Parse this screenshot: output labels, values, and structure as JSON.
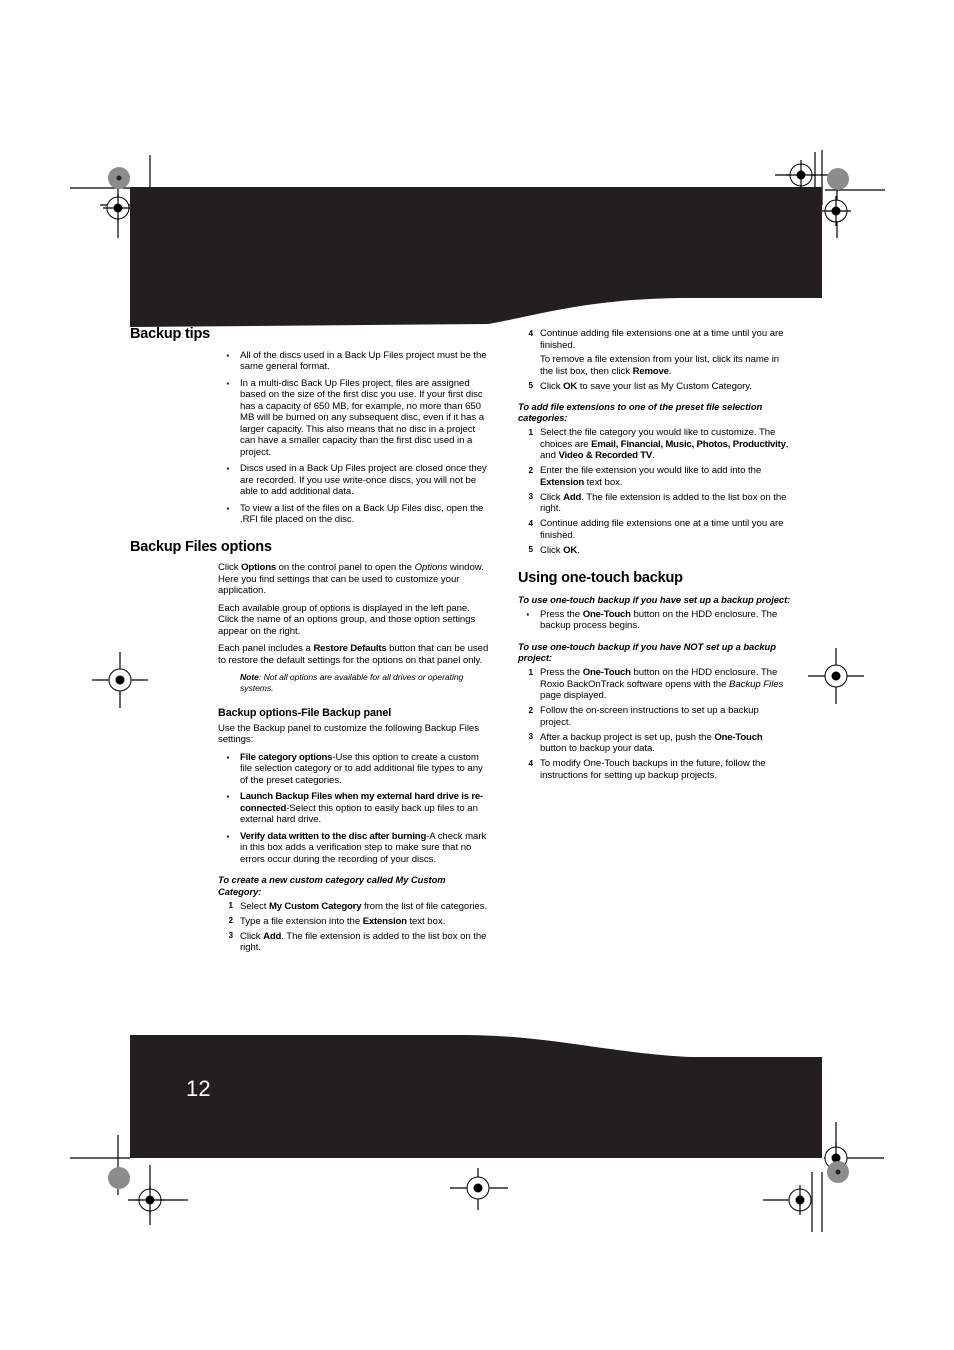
{
  "page": {
    "number": "12",
    "banner_color": "#231f20",
    "page_number_color": "#ffffff"
  },
  "left_column": {
    "backup_tips": {
      "heading": "Backup tips",
      "bullets": [
        "All of the discs used in a Back Up Files project must be the same general format.",
        "In a multi-disc Back Up Files project, files are assigned based on the size of the first disc you use. If your first disc has a capacity of 650 MB, for example, no more than 650 MB will be burned on any subsequent disc, even if it has a larger capacity. This also means that no disc in a project can have a smaller capacity than the first disc used in a project.",
        "Discs used in a Back Up Files project are closed once they are recorded. If you use write-once discs, you will not be able to add additional data.",
        "To view a list of the files on a Back Up Files disc, open the .RFI file placed on the disc."
      ]
    },
    "backup_files_options": {
      "heading": "Backup Files options",
      "paragraph_1": {
        "part_1": "Click ",
        "bold_1": "Options",
        "part_2": " on the control panel to open the ",
        "italic_1": "Options",
        "part_3": " window. Here you find settings that can be used to customize your application."
      },
      "paragraph_2": "Each available group of options is displayed in the left pane. Click the name of an options group, and those option settings appear on the right.",
      "paragraph_3": {
        "part_1": "Each panel includes a ",
        "bold_1": "Restore Defaults",
        "part_2": " button that can be used to restore the default settings for the options on that panel only."
      },
      "note": {
        "lead": "Note",
        "text": ": Not all options are available for all drives or operating systems."
      }
    },
    "file_backup_panel": {
      "heading": "Backup options-File Backup panel",
      "intro": "Use the Backup panel to customize the following Backup Files settings:",
      "bullets": [
        {
          "bold": "File category options",
          "rest": "-Use this option to create a custom file selection category or to add additional file types to any of the preset categories."
        },
        {
          "bold": "Launch Backup Files when my external hard drive is re-connected",
          "rest": "-Select this option to easily back up files to an external hard drive."
        },
        {
          "bold": "Verify data written to the disc after burning",
          "rest": "-A check mark in this box adds a verification step to make sure that no errors occur during the recording of your discs."
        }
      ]
    },
    "custom_category_procedure": {
      "title": "To create a new custom category called My Custom Category:",
      "steps": [
        {
          "num": "1",
          "part_1": "Select ",
          "bold_1": "My Custom Category",
          "part_2": " from the list of file categories."
        },
        {
          "num": "2",
          "part_1": "Type a file extension into the ",
          "bold_1": "Extension",
          "part_2": " text box."
        },
        {
          "num": "3",
          "part_1": "Click ",
          "bold_1": "Add",
          "part_2": ". The file extension is added to the list box on the right."
        }
      ]
    }
  },
  "right_column": {
    "continued_steps": [
      {
        "num": "4",
        "part_1": "Continue adding file extensions one at a time until you are finished.",
        "sub_part_1": "To remove a file extension from your list, click its name in the list box, then click ",
        "sub_bold_1": "Remove",
        "sub_part_2": "."
      },
      {
        "num": "5",
        "part_1": "Click ",
        "bold_1": "OK",
        "part_2": " to save your list as My Custom Category."
      }
    ],
    "preset_categories_procedure": {
      "title": "To add file extensions to one of the preset file selection categories:",
      "steps": [
        {
          "num": "1",
          "part_1": "Select the file category you would like to customize. The choices are ",
          "bold_1": "Email, Financial, Music, Photos, Productivity",
          "part_2": ", and ",
          "bold_2": "Video & Recorded TV",
          "part_3": "."
        },
        {
          "num": "2",
          "part_1": "Enter the file extension you would like to add into the ",
          "bold_1": "Extension",
          "part_2": " text box."
        },
        {
          "num": "3",
          "part_1": "Click ",
          "bold_1": "Add",
          "part_2": ". The file extension is added to the list box on the right."
        },
        {
          "num": "4",
          "part_1": "Continue adding file extensions one at a time until you are finished."
        },
        {
          "num": "5",
          "part_1": "Click ",
          "bold_1": "OK",
          "part_2": "."
        }
      ]
    },
    "one_touch_backup": {
      "heading": "Using one-touch backup",
      "procedure_set_up": {
        "title": "To use one-touch backup if you have set up a backup project:",
        "bullet": {
          "part_1": "Press the ",
          "bold_1": "One-Touch",
          "part_2": " button on the HDD enclosure. The backup process begins."
        }
      },
      "procedure_not_set_up": {
        "title": "To use one-touch backup if you have NOT set up a backup project:",
        "steps": [
          {
            "num": "1",
            "part_1": "Press the ",
            "bold_1": "One-Touch",
            "part_2": " button on the HDD enclosure. The Roxio BackOnTrack software opens with the ",
            "italic_1": "Backup Files",
            "part_3": " page displayed."
          },
          {
            "num": "2",
            "part_1": "Follow the on-screen instructions to set up a backup project."
          },
          {
            "num": "3",
            "part_1": "After a backup project is set up, push the ",
            "bold_1": "One-Touch",
            "part_2": " button to backup your data."
          },
          {
            "num": "4",
            "part_1": "To modify One-Touch backups in the future, follow the instructions for setting up backup projects."
          }
        ]
      }
    }
  }
}
